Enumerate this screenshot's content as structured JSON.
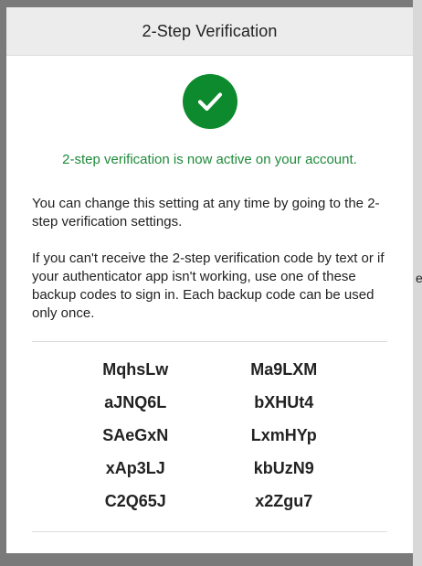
{
  "modal": {
    "title": "2-Step Verification",
    "success_message": "2-step verification is now active on your account.",
    "paragraph_1": "You can change this setting at any time by going to the 2-step verification settings.",
    "paragraph_2": "If you can't receive the 2-step verification code by text or if your authenticator app isn't working, use one of these backup codes to sign in. Each backup code can be used only once.",
    "backup_codes": [
      "MqhsLw",
      "Ma9LXM",
      "aJNQ6L",
      "bXHUt4",
      "SAeGxN",
      "LxmHYp",
      "xAp3LJ",
      "kbUzN9",
      "C2Q65J",
      "x2Zgu7"
    ]
  },
  "backdrop": {
    "partial_char": "e"
  },
  "colors": {
    "success_green": "#0e8a2e",
    "success_text": "#1e8a3a",
    "header_bg": "#ececec"
  }
}
